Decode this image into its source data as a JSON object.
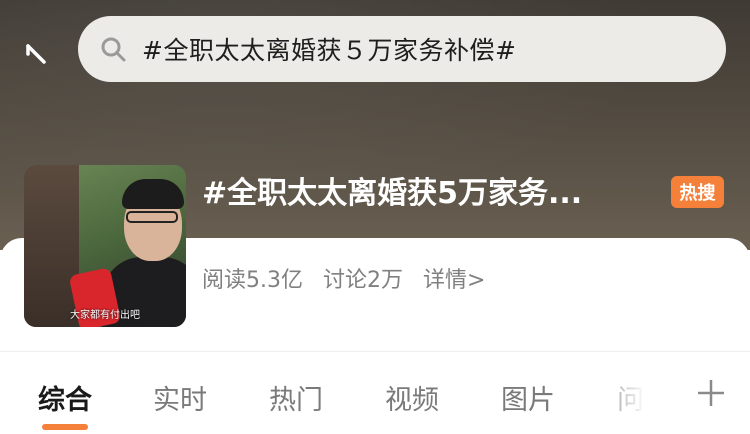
{
  "search": {
    "query": "#全职太太离婚获５万家务补偿#"
  },
  "topic": {
    "title": "#全职太太离婚获5万家务...",
    "badge": "热搜",
    "thumbnail_caption": "大家都有付出吧",
    "stats": {
      "reads": "阅读5.3亿",
      "discussions": "讨论2万",
      "details": "详情>"
    }
  },
  "tabs": [
    {
      "label": "综合",
      "active": true
    },
    {
      "label": "实时"
    },
    {
      "label": "热门"
    },
    {
      "label": "视频"
    },
    {
      "label": "图片"
    },
    {
      "label": "问答"
    }
  ],
  "colors": {
    "accent": "#f5803a",
    "hero_bg": "#4b443b"
  },
  "icons": {
    "back": "back-arrow-icon",
    "search": "search-icon",
    "add": "plus-icon"
  }
}
